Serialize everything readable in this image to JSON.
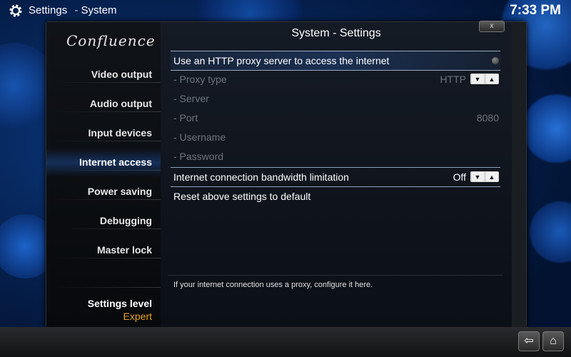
{
  "header": {
    "section": "Settings",
    "subsection": "System",
    "separator": "-",
    "clock": "7:33 PM"
  },
  "sidebar": {
    "logo": "Confluence",
    "items": [
      {
        "label": "Video output"
      },
      {
        "label": "Audio output"
      },
      {
        "label": "Input devices"
      },
      {
        "label": "Internet access"
      },
      {
        "label": "Power saving"
      },
      {
        "label": "Debugging"
      },
      {
        "label": "Master lock"
      }
    ],
    "selected": "Internet access",
    "settings_level_label": "Settings level",
    "settings_level_value": "Expert"
  },
  "panel": {
    "title": "System - Settings",
    "close_label": "x",
    "settings": [
      {
        "label": "Use an HTTP proxy server to access the internet",
        "value": "",
        "control": "radio",
        "enabled": true,
        "focused": true
      },
      {
        "label": "- Proxy type",
        "value": "HTTP",
        "control": "spinner",
        "enabled": false
      },
      {
        "label": "- Server",
        "value": "",
        "control": "text",
        "enabled": false
      },
      {
        "label": "- Port",
        "value": "8080",
        "control": "text",
        "enabled": false
      },
      {
        "label": "- Username",
        "value": "",
        "control": "text",
        "enabled": false
      },
      {
        "label": "- Password",
        "value": "",
        "control": "text",
        "enabled": false
      },
      {
        "label": "Internet connection bandwidth limitation",
        "value": "Off",
        "control": "spinner",
        "enabled": true
      },
      {
        "label": "Reset above settings to default",
        "value": "",
        "control": "button",
        "enabled": true
      }
    ],
    "hint": "If your internet connection uses a proxy, configure it here."
  },
  "icons": {
    "gear": "gear-icon",
    "back": "back-arrow-icon",
    "home": "home-icon",
    "spinner_down": "▼",
    "spinner_up": "▲",
    "back_glyph": "⇦",
    "home_glyph": "⌂"
  },
  "colors": {
    "accent": "#e8a020",
    "background": "#04183d",
    "disabled_text": "#6e737b"
  }
}
